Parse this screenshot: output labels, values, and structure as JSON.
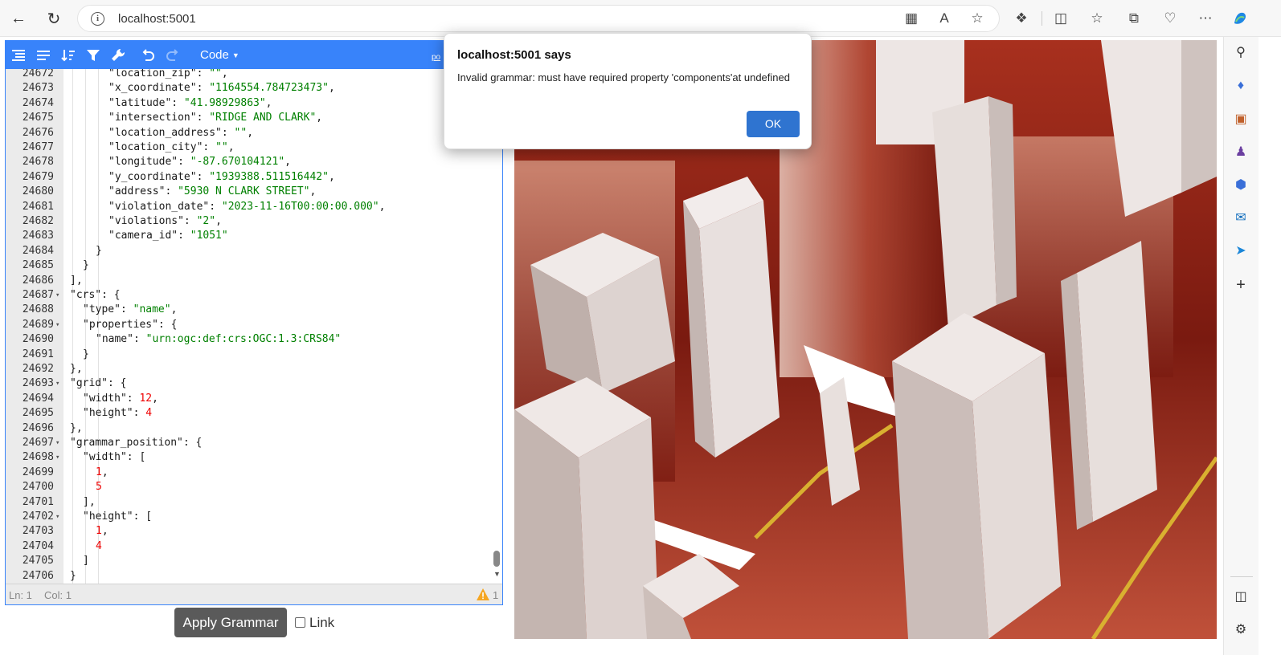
{
  "browser": {
    "url": "localhost:5001"
  },
  "editor": {
    "mode_label": "Code",
    "powered_label": "po",
    "status": {
      "ln": "Ln: 1",
      "col": "Col: 1",
      "warning_count": "1"
    },
    "lines": [
      {
        "num": "24672",
        "indent": 4,
        "fold": "",
        "parts": [
          [
            "k",
            "\"location_zip\": "
          ],
          [
            "s",
            "\"\""
          ],
          [
            "k",
            ","
          ]
        ]
      },
      {
        "num": "24673",
        "indent": 4,
        "fold": "",
        "parts": [
          [
            "k",
            "\"x_coordinate\": "
          ],
          [
            "s",
            "\"1164554.784723473\""
          ],
          [
            "k",
            ","
          ]
        ]
      },
      {
        "num": "24674",
        "indent": 4,
        "fold": "",
        "parts": [
          [
            "k",
            "\"latitude\": "
          ],
          [
            "s",
            "\"41.98929863\""
          ],
          [
            "k",
            ","
          ]
        ]
      },
      {
        "num": "24675",
        "indent": 4,
        "fold": "",
        "parts": [
          [
            "k",
            "\"intersection\": "
          ],
          [
            "s",
            "\"RIDGE AND CLARK\""
          ],
          [
            "k",
            ","
          ]
        ]
      },
      {
        "num": "24676",
        "indent": 4,
        "fold": "",
        "parts": [
          [
            "k",
            "\"location_address\": "
          ],
          [
            "s",
            "\"\""
          ],
          [
            "k",
            ","
          ]
        ]
      },
      {
        "num": "24677",
        "indent": 4,
        "fold": "",
        "parts": [
          [
            "k",
            "\"location_city\": "
          ],
          [
            "s",
            "\"\""
          ],
          [
            "k",
            ","
          ]
        ]
      },
      {
        "num": "24678",
        "indent": 4,
        "fold": "",
        "parts": [
          [
            "k",
            "\"longitude\": "
          ],
          [
            "s",
            "\"-87.670104121\""
          ],
          [
            "k",
            ","
          ]
        ]
      },
      {
        "num": "24679",
        "indent": 4,
        "fold": "",
        "parts": [
          [
            "k",
            "\"y_coordinate\": "
          ],
          [
            "s",
            "\"1939388.511516442\""
          ],
          [
            "k",
            ","
          ]
        ]
      },
      {
        "num": "24680",
        "indent": 4,
        "fold": "",
        "parts": [
          [
            "k",
            "\"address\": "
          ],
          [
            "s",
            "\"5930 N CLARK STREET\""
          ],
          [
            "k",
            ","
          ]
        ]
      },
      {
        "num": "24681",
        "indent": 4,
        "fold": "",
        "parts": [
          [
            "k",
            "\"violation_date\": "
          ],
          [
            "s",
            "\"2023-11-16T00:00:00.000\""
          ],
          [
            "k",
            ","
          ]
        ]
      },
      {
        "num": "24682",
        "indent": 4,
        "fold": "",
        "parts": [
          [
            "k",
            "\"violations\": "
          ],
          [
            "s",
            "\"2\""
          ],
          [
            "k",
            ","
          ]
        ]
      },
      {
        "num": "24683",
        "indent": 4,
        "fold": "",
        "parts": [
          [
            "k",
            "\"camera_id\": "
          ],
          [
            "s",
            "\"1051\""
          ]
        ]
      },
      {
        "num": "24684",
        "indent": 3,
        "fold": "",
        "parts": [
          [
            "k",
            "}"
          ]
        ]
      },
      {
        "num": "24685",
        "indent": 2,
        "fold": "",
        "parts": [
          [
            "k",
            "}"
          ]
        ]
      },
      {
        "num": "24686",
        "indent": 1,
        "fold": "",
        "parts": [
          [
            "k",
            "],"
          ]
        ]
      },
      {
        "num": "24687",
        "indent": 1,
        "fold": "▾",
        "parts": [
          [
            "k",
            "\"crs\": {"
          ]
        ]
      },
      {
        "num": "24688",
        "indent": 2,
        "fold": "",
        "parts": [
          [
            "k",
            "\"type\": "
          ],
          [
            "s",
            "\"name\""
          ],
          [
            "k",
            ","
          ]
        ]
      },
      {
        "num": "24689",
        "indent": 2,
        "fold": "▾",
        "parts": [
          [
            "k",
            "\"properties\": {"
          ]
        ]
      },
      {
        "num": "24690",
        "indent": 3,
        "fold": "",
        "parts": [
          [
            "k",
            "\"name\": "
          ],
          [
            "s",
            "\"urn:ogc:def:crs:OGC:1.3:CRS84\""
          ]
        ]
      },
      {
        "num": "24691",
        "indent": 2,
        "fold": "",
        "parts": [
          [
            "k",
            "}"
          ]
        ]
      },
      {
        "num": "24692",
        "indent": 1,
        "fold": "",
        "parts": [
          [
            "k",
            "},"
          ]
        ]
      },
      {
        "num": "24693",
        "indent": 1,
        "fold": "▾",
        "parts": [
          [
            "k",
            "\"grid\": {"
          ]
        ]
      },
      {
        "num": "24694",
        "indent": 2,
        "fold": "",
        "parts": [
          [
            "k",
            "\"width\": "
          ],
          [
            "n",
            "12"
          ],
          [
            "k",
            ","
          ]
        ]
      },
      {
        "num": "24695",
        "indent": 2,
        "fold": "",
        "parts": [
          [
            "k",
            "\"height\": "
          ],
          [
            "n",
            "4"
          ]
        ]
      },
      {
        "num": "24696",
        "indent": 1,
        "fold": "",
        "parts": [
          [
            "k",
            "},"
          ]
        ]
      },
      {
        "num": "24697",
        "indent": 1,
        "fold": "▾",
        "parts": [
          [
            "k",
            "\"grammar_position\": {"
          ]
        ]
      },
      {
        "num": "24698",
        "indent": 2,
        "fold": "▾",
        "parts": [
          [
            "k",
            "\"width\": ["
          ]
        ]
      },
      {
        "num": "24699",
        "indent": 3,
        "fold": "",
        "parts": [
          [
            "n",
            "1"
          ],
          [
            "k",
            ","
          ]
        ]
      },
      {
        "num": "24700",
        "indent": 3,
        "fold": "",
        "parts": [
          [
            "n",
            "5"
          ]
        ]
      },
      {
        "num": "24701",
        "indent": 2,
        "fold": "",
        "parts": [
          [
            "k",
            "],"
          ]
        ]
      },
      {
        "num": "24702",
        "indent": 2,
        "fold": "▾",
        "parts": [
          [
            "k",
            "\"height\": ["
          ]
        ]
      },
      {
        "num": "24703",
        "indent": 3,
        "fold": "",
        "parts": [
          [
            "n",
            "1"
          ],
          [
            "k",
            ","
          ]
        ]
      },
      {
        "num": "24704",
        "indent": 3,
        "fold": "",
        "parts": [
          [
            "n",
            "4"
          ]
        ]
      },
      {
        "num": "24705",
        "indent": 2,
        "fold": "",
        "parts": [
          [
            "k",
            "]"
          ]
        ]
      },
      {
        "num": "24706",
        "indent": 1,
        "fold": "",
        "parts": [
          [
            "k",
            "}"
          ]
        ]
      }
    ]
  },
  "controls": {
    "apply_label": "Apply Grammar",
    "link_label": "Link"
  },
  "dialog": {
    "title": "localhost:5001 says",
    "message": "Invalid grammar: must have required property 'components'at undefined",
    "ok_label": "OK"
  },
  "colors": {
    "accent": "#3883fa",
    "string": "#008000",
    "number": "#ee0000",
    "ok_button": "#2f74d0"
  }
}
